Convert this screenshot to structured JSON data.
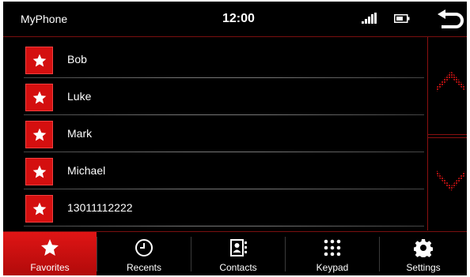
{
  "status_bar": {
    "app_title": "MyPhone",
    "time": "12:00",
    "icons": [
      "signal-icon",
      "battery-icon",
      "back-icon"
    ]
  },
  "favorites": [
    {
      "name": "Bob"
    },
    {
      "name": "Luke"
    },
    {
      "name": "Mark"
    },
    {
      "name": "Michael"
    },
    {
      "name": "13011112222"
    }
  ],
  "side_controls": {
    "icons": [
      "scroll-up-icon",
      "scroll-down-icon"
    ]
  },
  "bottom_nav": {
    "active": "Favorites",
    "tabs": [
      {
        "label": "Favorites",
        "icon": "star-icon"
      },
      {
        "label": "Recents",
        "icon": "clock-icon"
      },
      {
        "label": "Contacts",
        "icon": "contact-card-icon"
      },
      {
        "label": "Keypad",
        "icon": "keypad-icon"
      },
      {
        "label": "Settings",
        "icon": "gear-icon"
      }
    ]
  },
  "colors": {
    "accent": "#d40f0f",
    "background": "#000000",
    "text": "#ffffff"
  }
}
